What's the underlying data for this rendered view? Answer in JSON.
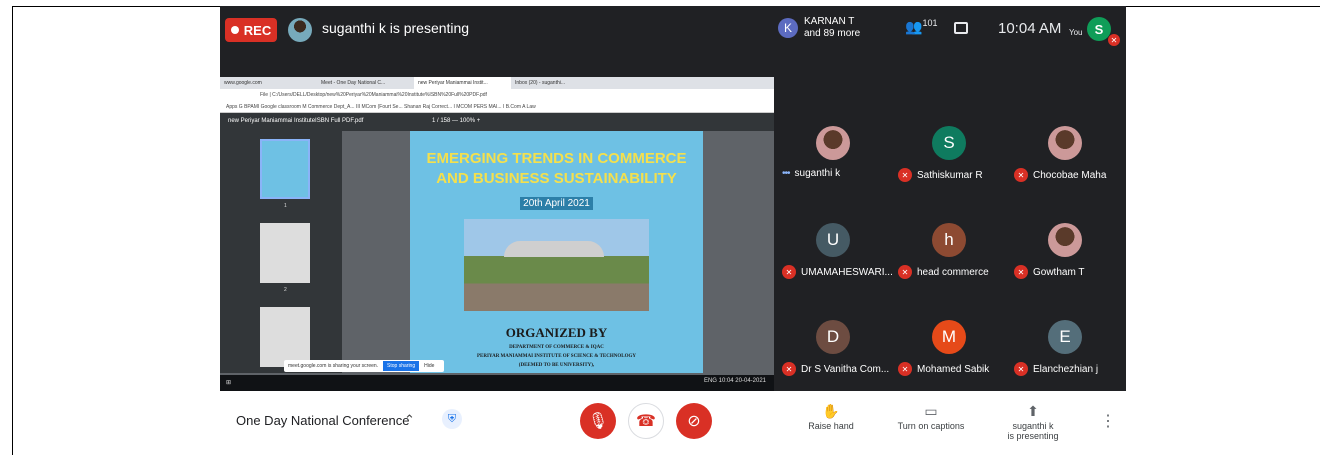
{
  "topbar": {
    "rec_label": "REC",
    "presenting": "suganthi k is presenting",
    "chip_initial": "K",
    "chip_name": "KARNAN T",
    "chip_more": "and 89 more",
    "people_count": "101",
    "clock": "10:04 AM",
    "you_label": "You",
    "self_initial": "S"
  },
  "screen": {
    "tabs": [
      "www.google.com",
      "Meet - One Day National C...",
      "new Periyar Maniammai Instit...",
      "Inbox (20) - suganthi..."
    ],
    "address": "File | C:/Users/DELL/Desktop/new%20Periyar%20Maniammai%20Institute%ISBN%20Full%20PDF.pdf",
    "bookmarks": "Apps   G   BPAMI   Google classroom   M   Commerce Dept_A...   III MCom (Fourt Se...   Shanan Raj Correct...   I MCOM PERS MAI...   I B.Com A Law",
    "pdf_name": "new Periyar Maniammai InstituteISBN Full PDF.pdf",
    "pdf_pages": "1 / 158   —  100%  +",
    "thumb_labels": [
      "1",
      "2"
    ],
    "page_heading": "EMERGING TRENDS IN COMMERCE AND BUSINESS SUSTAINABILITY",
    "page_date": "20th April 2021",
    "organized": "ORGANIZED BY",
    "dept": "DEPARTMENT OF COMMERCE & IQAC",
    "inst": "PERIYAR MANIAMMAI INSTITUTE OF SCIENCE & TECHNOLOGY",
    "deemed": "(DEEMED TO BE UNIVERSITY),",
    "share_text": "meet.google.com is sharing your screen.",
    "stop_sharing": "Stop sharing",
    "hide": "Hide",
    "tray": "ENG  10:04  20-04-2021"
  },
  "participants": [
    {
      "name": "suganthi k",
      "initial": "",
      "color": "",
      "muted": false,
      "photo": true
    },
    {
      "name": "Sathiskumar R",
      "initial": "S",
      "color": "#0f7b5f",
      "muted": true,
      "photo": false
    },
    {
      "name": "Chocobae Maha",
      "initial": "",
      "color": "",
      "muted": true,
      "photo": true
    },
    {
      "name": "UMAMAHESWARI...",
      "initial": "U",
      "color": "#455a64",
      "muted": true,
      "photo": false
    },
    {
      "name": "head commerce",
      "initial": "h",
      "color": "#8d4a32",
      "muted": true,
      "photo": false
    },
    {
      "name": "Gowtham T",
      "initial": "",
      "color": "",
      "muted": true,
      "photo": true
    },
    {
      "name": "Dr S Vanitha Com...",
      "initial": "D",
      "color": "#6d4c41",
      "muted": true,
      "photo": false
    },
    {
      "name": "Mohamed Sabik",
      "initial": "M",
      "color": "#e64a19",
      "muted": true,
      "photo": false
    },
    {
      "name": "Elanchezhian j",
      "initial": "E",
      "color": "#546e7a",
      "muted": true,
      "photo": false
    }
  ],
  "bottom": {
    "meeting_title": "One Day National Conference",
    "raise_hand": "Raise hand",
    "captions": "Turn on captions",
    "presenting_line1": "suganthi k",
    "presenting_line2": "is presenting"
  },
  "colors": {
    "danger": "#d93025",
    "meet_bg": "#202124",
    "pdf_bg": "#6ec1e4"
  }
}
